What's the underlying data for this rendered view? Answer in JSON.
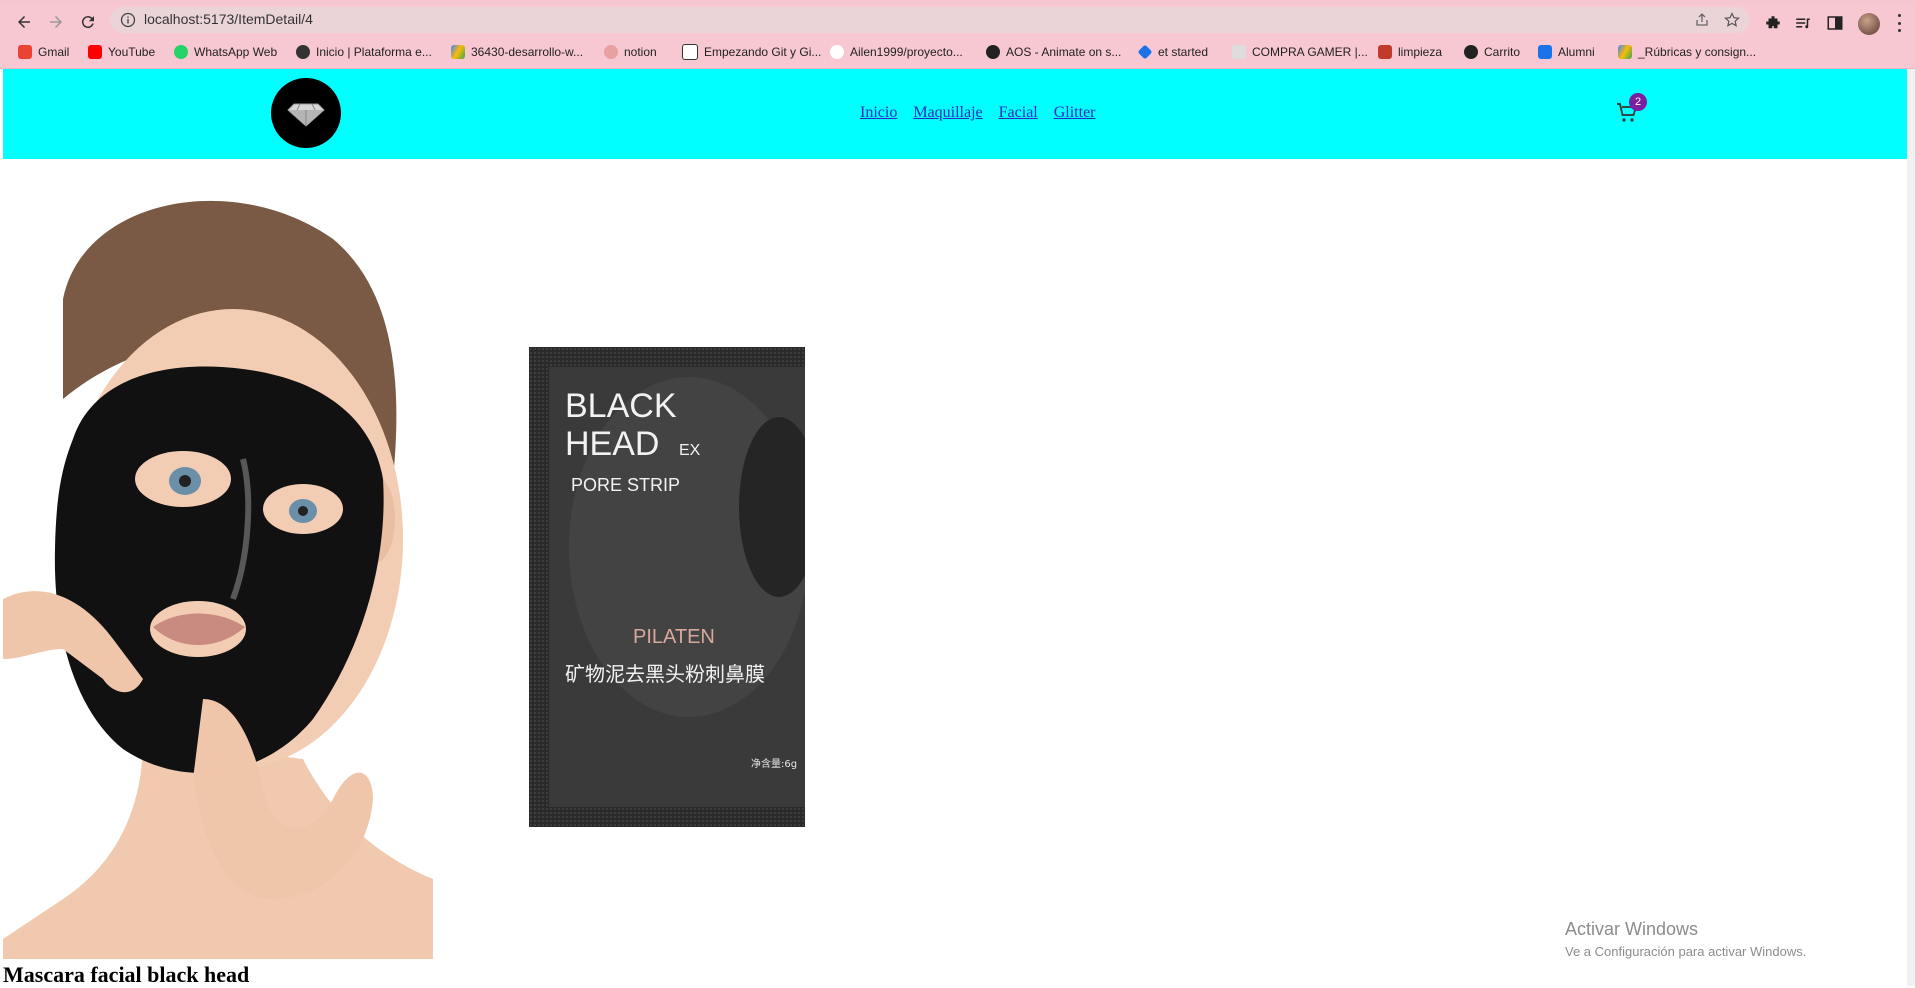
{
  "browser": {
    "url": "localhost:5173/ItemDetail/4",
    "bookmarks": [
      {
        "label": "Gmail",
        "color": "#ea4335"
      },
      {
        "label": "YouTube",
        "color": "#ff0000"
      },
      {
        "label": "WhatsApp Web",
        "color": "#25d366"
      },
      {
        "label": "Inicio | Plataforma e...",
        "color": "#333333"
      },
      {
        "label": "36430-desarrollo-w...",
        "color": "#4285f4"
      },
      {
        "label": "notion",
        "color": "#e8a0a0"
      },
      {
        "label": "Empezando Git y Gi...",
        "color": "#333333"
      },
      {
        "label": "Ailen1999/proyecto...",
        "color": "#ffffff"
      },
      {
        "label": "AOS - Animate on s...",
        "color": "#222222"
      },
      {
        "label": "et started",
        "color": "#1a73e8"
      },
      {
        "label": "COMPRA GAMER |...",
        "color": "#888888"
      },
      {
        "label": "limpieza",
        "color": "#c0392b"
      },
      {
        "label": "Carrito",
        "color": "#222222"
      },
      {
        "label": "Alumni",
        "color": "#1a73e8"
      },
      {
        "label": "_Rúbricas y consign...",
        "color": "#4285f4"
      }
    ]
  },
  "header": {
    "nav": [
      {
        "label": "Inicio"
      },
      {
        "label": "Maquillaje"
      },
      {
        "label": "Facial"
      },
      {
        "label": "Glitter"
      }
    ],
    "cart_count": "2"
  },
  "product": {
    "title": "Mascara facial black head",
    "package_text": {
      "line1": "BLACK",
      "line2": "HEAD",
      "line2_suffix": "EX",
      "line3": "PORE STRIP",
      "brand": "PILATEN",
      "chinese": "矿物泥去黑头粉刺鼻膜",
      "net": "净含量:6g"
    }
  },
  "os_watermark": {
    "line1": "Activar Windows",
    "line2": "Ve a Configuración para activar Windows."
  },
  "colors": {
    "header_bg": "#00ffff",
    "browser_chrome": "#f8c8d2",
    "badge": "#7b1fa2",
    "link": "#2b2bbf"
  },
  "icons": [
    "back-arrow-icon",
    "forward-arrow-icon",
    "reload-icon",
    "info-icon",
    "share-icon",
    "star-icon",
    "extensions-icon",
    "media-icon",
    "sidepanel-icon",
    "diamond-logo-icon",
    "cart-icon"
  ]
}
